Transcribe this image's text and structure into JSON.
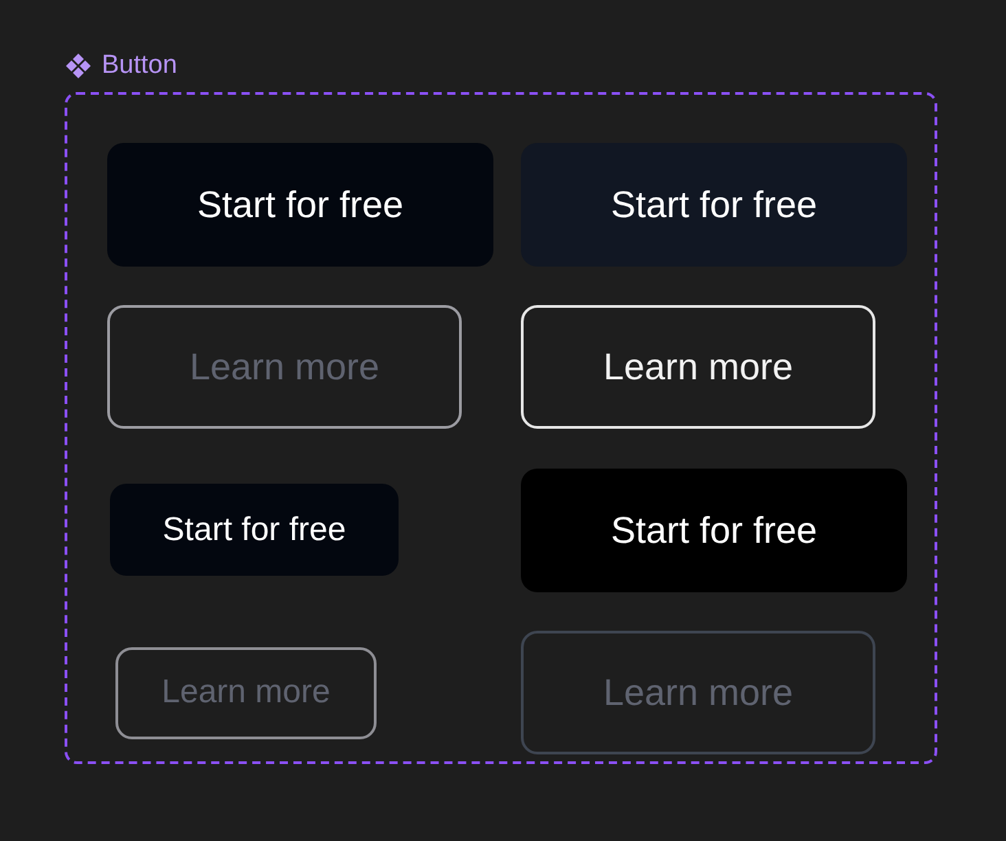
{
  "component": {
    "title": "Button"
  },
  "buttons": [
    {
      "label": "Start for free",
      "kind": "solid",
      "color": "#03070f",
      "disabled": false
    },
    {
      "label": "Start for free",
      "kind": "solid",
      "color": "#111723",
      "disabled": false
    },
    {
      "label": "Learn more",
      "kind": "outline",
      "color": "#9c9ca2",
      "disabled": true
    },
    {
      "label": "Learn more",
      "kind": "outline",
      "color": "#e6e6e6",
      "disabled": false
    },
    {
      "label": "Start for free",
      "kind": "compact",
      "color": "#03070f",
      "disabled": false
    },
    {
      "label": "Start for free",
      "kind": "solid",
      "color": "#000000",
      "disabled": false
    },
    {
      "label": "Learn more",
      "kind": "compactoutline",
      "color": "#8e8e94",
      "disabled": true
    },
    {
      "label": "Learn more",
      "kind": "outline",
      "color": "#3e4551",
      "disabled": true
    }
  ]
}
